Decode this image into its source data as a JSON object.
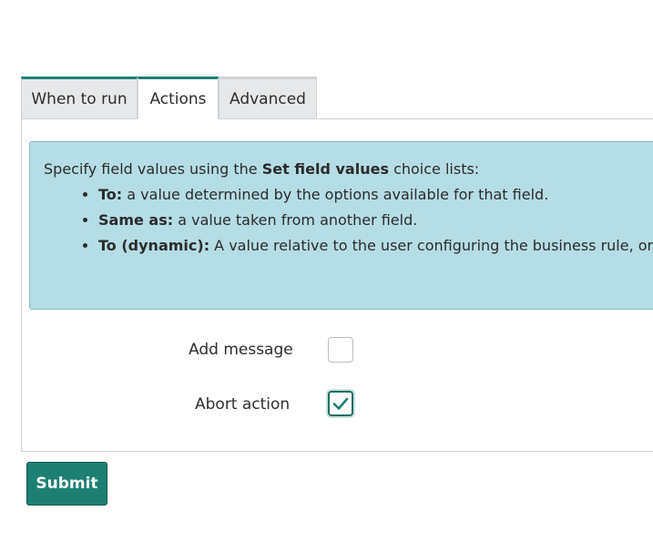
{
  "tabs": [
    {
      "label": "When to run"
    },
    {
      "label": "Actions"
    },
    {
      "label": "Advanced"
    }
  ],
  "info": {
    "intro_prefix": "Specify field values using the ",
    "intro_bold": "Set field values",
    "intro_suffix": " choice lists:",
    "items": [
      {
        "term": "To:",
        "text": " a value determined by the options available for that field."
      },
      {
        "term": "Same as:",
        "text": " a value taken from another field."
      },
      {
        "term": "To (dynamic):",
        "text": " A value relative to the user configuring the business rule, or a"
      }
    ]
  },
  "form": {
    "add_message_label": "Add message",
    "add_message_checked": false,
    "abort_action_label": "Abort action",
    "abort_action_checked": true
  },
  "submit_label": "Submit",
  "colors": {
    "accent": "#1d7f73",
    "info_bg": "#b5dde5"
  }
}
